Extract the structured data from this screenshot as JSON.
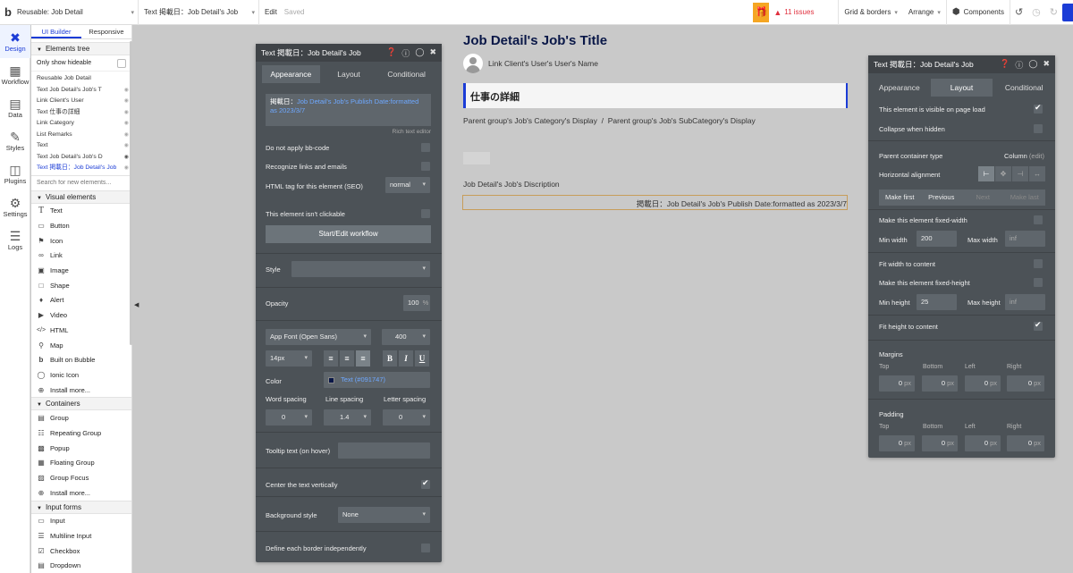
{
  "topbar": {
    "page_select": "Reusable: Job Detail",
    "element_select": "Text 掲載日：Job Detail's Job",
    "edit_label": "Edit",
    "saved_label": "Saved",
    "issues_label": "11 issues",
    "grid_label": "Grid & borders",
    "arrange_label": "Arrange",
    "components_label": "Components"
  },
  "nav": [
    {
      "label": "Design",
      "icon": "design-icon"
    },
    {
      "label": "Workflow",
      "icon": "workflow-icon"
    },
    {
      "label": "Data",
      "icon": "data-icon"
    },
    {
      "label": "Styles",
      "icon": "styles-icon"
    },
    {
      "label": "Plugins",
      "icon": "plugins-icon"
    },
    {
      "label": "Settings",
      "icon": "settings-icon"
    },
    {
      "label": "Logs",
      "icon": "logs-icon"
    }
  ],
  "elpanel": {
    "tab_builder": "UI Builder",
    "tab_responsive": "Responsive",
    "tree_title": "Elements tree",
    "only_hideable": "Only show hideable",
    "tree_items": [
      "Reusable Job Detail",
      "Text Job Detail's Job's T",
      "Link Client's User",
      "Text 仕事の詳細",
      "Link Category",
      "List Remarks",
      "Text",
      "Text Job Detail's Job's D",
      "Text 掲載日：Job Detail's Job"
    ],
    "search_placeholder": "Search for new elements...",
    "visual_title": "Visual elements",
    "visual_items": [
      "Text",
      "Button",
      "Icon",
      "Link",
      "Image",
      "Shape",
      "Alert",
      "Video",
      "HTML",
      "Map",
      "Built on Bubble",
      "Ionic Icon",
      "Install more..."
    ],
    "containers_title": "Containers",
    "container_items": [
      "Group",
      "Repeating Group",
      "Popup",
      "Floating Group",
      "Group Focus",
      "Install more..."
    ],
    "forms_title": "Input forms",
    "form_items": [
      "Input",
      "Multiline Input",
      "Checkbox",
      "Dropdown"
    ]
  },
  "canvas": {
    "job_title": "Job Detail's Job's Title",
    "client_name": "Link Client's User's User's Name",
    "section_heading": "仕事の詳細",
    "category_line": "Parent group's Job's Category's Display  /  Parent group's Job's SubCategory's Display",
    "description": "Job Detail's Job's Discription",
    "publish_date": "掲載日：Job Detail's Job's Publish Date:formatted as 2023/3/7"
  },
  "appearance_panel": {
    "title": "Text 掲載日：Job Detail's Job",
    "tabs": [
      "Appearance",
      "Layout",
      "Conditional"
    ],
    "content_prefix": "掲載日：",
    "content_dynamic": "Job Detail's Job's Publish Date:formatted as 2023/3/7",
    "rich_editor": "Rich text editor",
    "no_bbcode": "Do not apply bb-code",
    "recognize_links": "Recognize links and emails",
    "html_tag_label": "HTML tag for this element (SEO)",
    "html_tag_value": "normal",
    "not_clickable": "This element isn't clickable",
    "workflow_btn": "Start/Edit workflow",
    "style_label": "Style",
    "opacity_label": "Opacity",
    "opacity_value": "100",
    "opacity_unit": "%",
    "font_value": "App Font (Open Sans)",
    "weight_value": "400",
    "size_value": "14px",
    "bold": "B",
    "italic": "I",
    "underline": "U",
    "color_label": "Color",
    "color_value": "Text (#091747)",
    "color_hex": "#091747",
    "word_spacing_label": "Word spacing",
    "line_spacing_label": "Line spacing",
    "letter_spacing_label": "Letter spacing",
    "word_spacing": "0",
    "line_spacing": "1.4",
    "letter_spacing": "0",
    "tooltip_label": "Tooltip text (on hover)",
    "center_vert": "Center the text vertically",
    "bg_style_label": "Background style",
    "bg_style_value": "None",
    "border_label": "Define each border independently"
  },
  "layout_panel": {
    "title": "Text 掲載日：Job Detail's Job",
    "tabs": [
      "Appearance",
      "Layout",
      "Conditional"
    ],
    "visible_on_load": "This element is visible on page load",
    "collapse_hidden": "Collapse when hidden",
    "parent_type_label": "Parent container type",
    "parent_type_value": "Column",
    "parent_type_edit": "(edit)",
    "h_align": "Horizontal alignment",
    "make_first": "Make first",
    "previous": "Previous",
    "next": "Next",
    "make_last": "Make last",
    "fixed_width": "Make this element fixed-width",
    "min_width_label": "Min width",
    "min_width": "200",
    "max_width_label": "Max width",
    "max_width": "inf",
    "fit_width": "Fit width to content",
    "fixed_height": "Make this element fixed-height",
    "min_height_label": "Min height",
    "min_height": "25",
    "max_height_label": "Max height",
    "max_height": "inf",
    "fit_height": "Fit height to content",
    "margins_label": "Margins",
    "padding_label": "Padding",
    "sides": [
      "Top",
      "Bottom",
      "Left",
      "Right"
    ],
    "zero": "0",
    "px": "px"
  }
}
